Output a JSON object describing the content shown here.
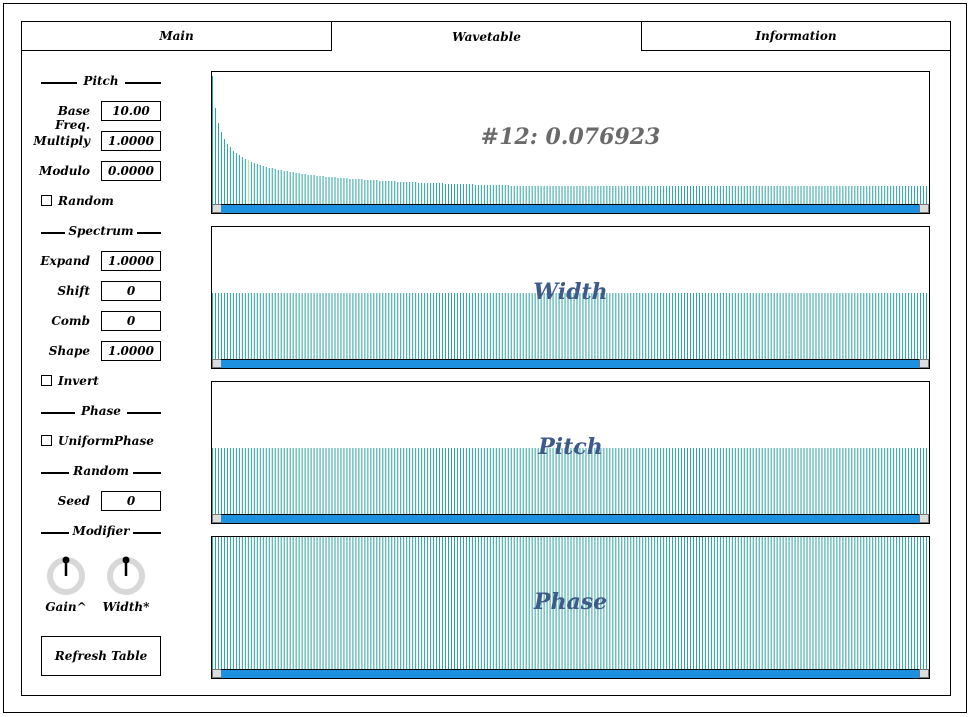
{
  "tabs": [
    {
      "label": "Main",
      "active": false
    },
    {
      "label": "Wavetable",
      "active": true
    },
    {
      "label": "Information",
      "active": false
    }
  ],
  "sections": {
    "pitch": "Pitch",
    "spectrum": "Spectrum",
    "phase": "Phase",
    "random": "Random",
    "modifier": "Modifier"
  },
  "fields": {
    "base_freq": {
      "label": "Base Freq.",
      "value": "10.00"
    },
    "multiply": {
      "label": "Multiply",
      "value": "1.0000"
    },
    "modulo": {
      "label": "Modulo",
      "value": "0.0000"
    },
    "expand": {
      "label": "Expand",
      "value": "1.0000"
    },
    "shift": {
      "label": "Shift",
      "value": "0"
    },
    "comb": {
      "label": "Comb",
      "value": "0"
    },
    "shape": {
      "label": "Shape",
      "value": "1.0000"
    },
    "seed": {
      "label": "Seed",
      "value": "0"
    }
  },
  "checkboxes": {
    "random": {
      "label": "Random",
      "checked": false
    },
    "invert": {
      "label": "Invert",
      "checked": false
    },
    "uniform_phase": {
      "label": "UniformPhase",
      "checked": false
    }
  },
  "knobs": {
    "gain": {
      "label": "Gain^"
    },
    "width": {
      "label": "Width*"
    }
  },
  "refresh_button": "Refresh Table",
  "graphs": {
    "gain": {
      "label": "#12: 0.076923",
      "bar_count": 240,
      "profile": "decay",
      "level": 1.0,
      "highlight_index": 12
    },
    "width": {
      "label": "Width",
      "bar_count": 240,
      "profile": "flat",
      "level": 0.5
    },
    "pitch": {
      "label": "Pitch",
      "bar_count": 240,
      "profile": "flat",
      "level": 0.5
    },
    "phase": {
      "label": "Phase",
      "bar_count": 240,
      "profile": "flat",
      "level": 1.0
    }
  },
  "colors": {
    "bar": "#2aa3a3",
    "highlight": "#9fe09f",
    "scrollbar": "#1e90e0"
  }
}
